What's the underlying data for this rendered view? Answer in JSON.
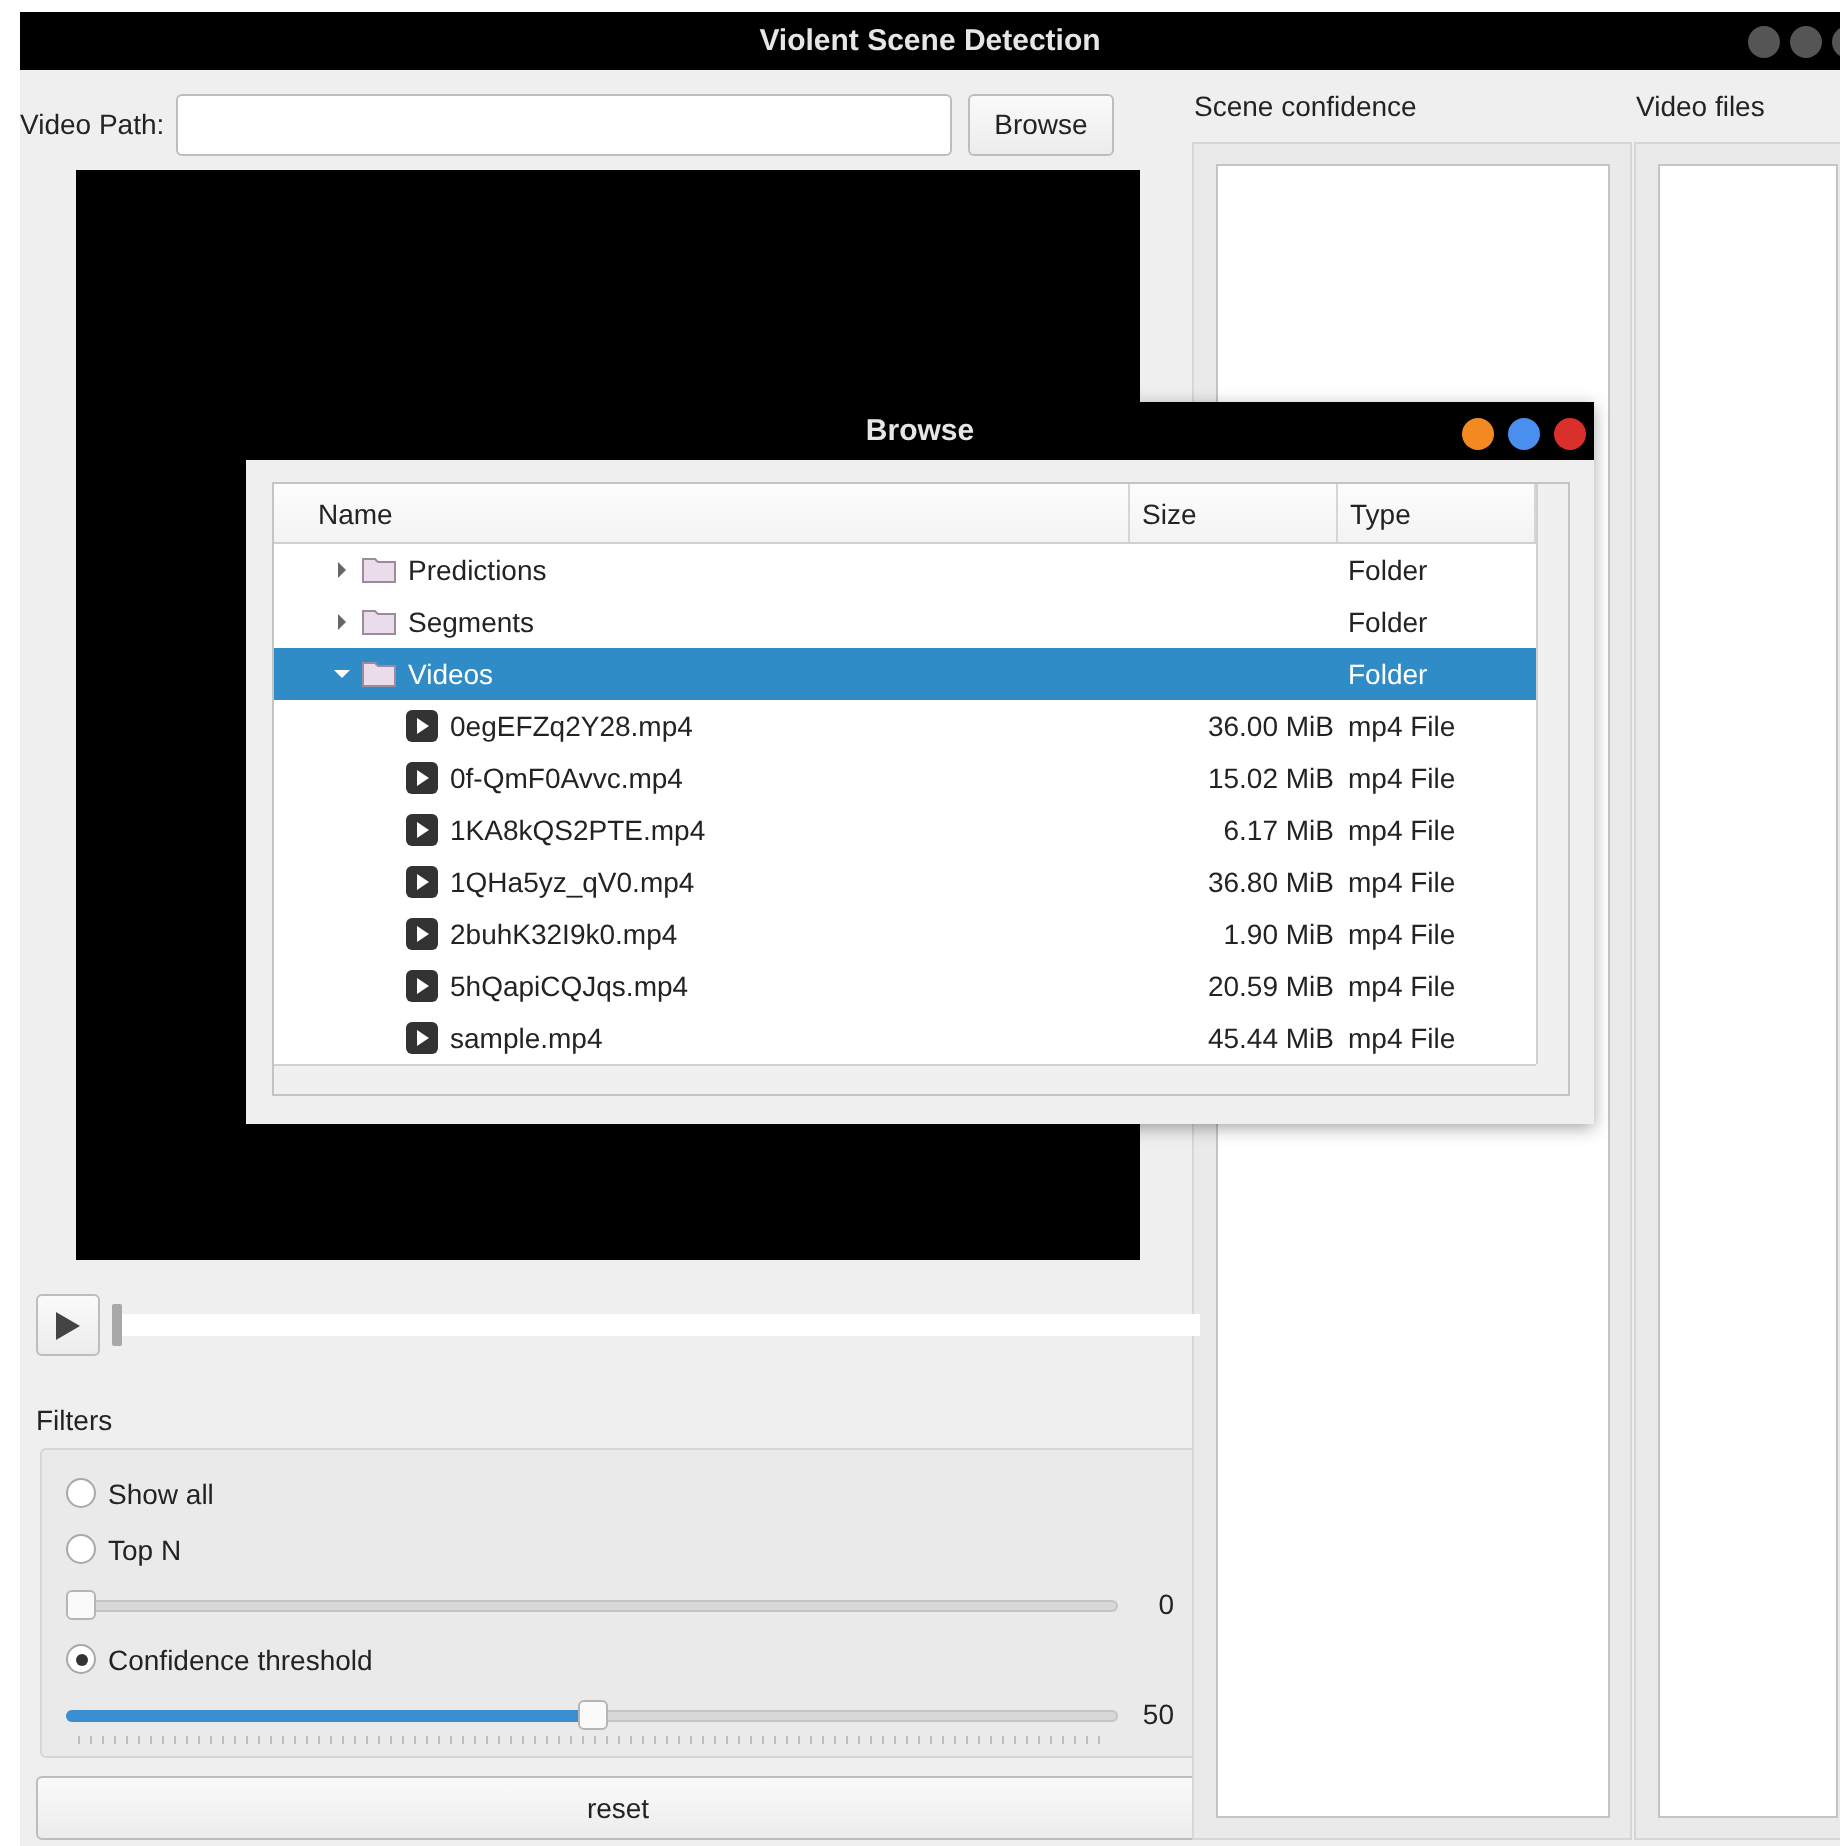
{
  "window": {
    "title": "Violent Scene Detection"
  },
  "video_path": {
    "label": "Video Path:",
    "button": "Browse"
  },
  "player": {
    "seek": {
      "level": 0
    }
  },
  "scene_confidence": {
    "label": "Scene confidence"
  },
  "video_files": {
    "label": "Video files"
  },
  "filters": {
    "title": "Filters",
    "options": [
      {
        "label": "Show all",
        "selected": false
      },
      {
        "label": "Top N",
        "selected": false,
        "slider": {
          "kind": "plain",
          "level": 0,
          "reading": "0"
        }
      },
      {
        "label": "Confidence threshold",
        "selected": true,
        "slider": {
          "kind": "ticked",
          "level": 0.5,
          "reading": "50"
        }
      }
    ]
  },
  "reset_button": "reset",
  "dialog": {
    "title": "Browse",
    "columns": [
      "Name",
      "Size",
      "Type"
    ],
    "rows": [
      {
        "name": "Predictions",
        "size": "",
        "type": "Folder",
        "expanded": false,
        "selected": false
      },
      {
        "name": "Segments",
        "size": "",
        "type": "Folder",
        "expanded": false,
        "selected": false
      },
      {
        "name": "Videos",
        "size": "",
        "type": "Folder",
        "expanded": true,
        "selected": true,
        "children": [
          {
            "name": "0egEFZq2Y28.mp4",
            "size": "36.00 MiB",
            "type": "mp4 File",
            "selected": false
          },
          {
            "name": "0f-QmF0Avvc.mp4",
            "size": "15.02 MiB",
            "type": "mp4 File",
            "selected": false
          },
          {
            "name": "1KA8kQS2PTE.mp4",
            "size": "6.17 MiB",
            "type": "mp4 File",
            "selected": false
          },
          {
            "name": "1QHa5yz_qV0.mp4",
            "size": "36.80 MiB",
            "type": "mp4 File",
            "selected": false
          },
          {
            "name": "2buhK32I9k0.mp4",
            "size": "1.90 MiB",
            "type": "mp4 File",
            "selected": false
          },
          {
            "name": "5hQapiCQJqs.mp4",
            "size": "20.59 MiB",
            "type": "mp4 File",
            "selected": false
          },
          {
            "name": "sample.mp4",
            "size": "45.44 MiB",
            "type": "mp4 File",
            "selected": false
          }
        ]
      }
    ]
  }
}
